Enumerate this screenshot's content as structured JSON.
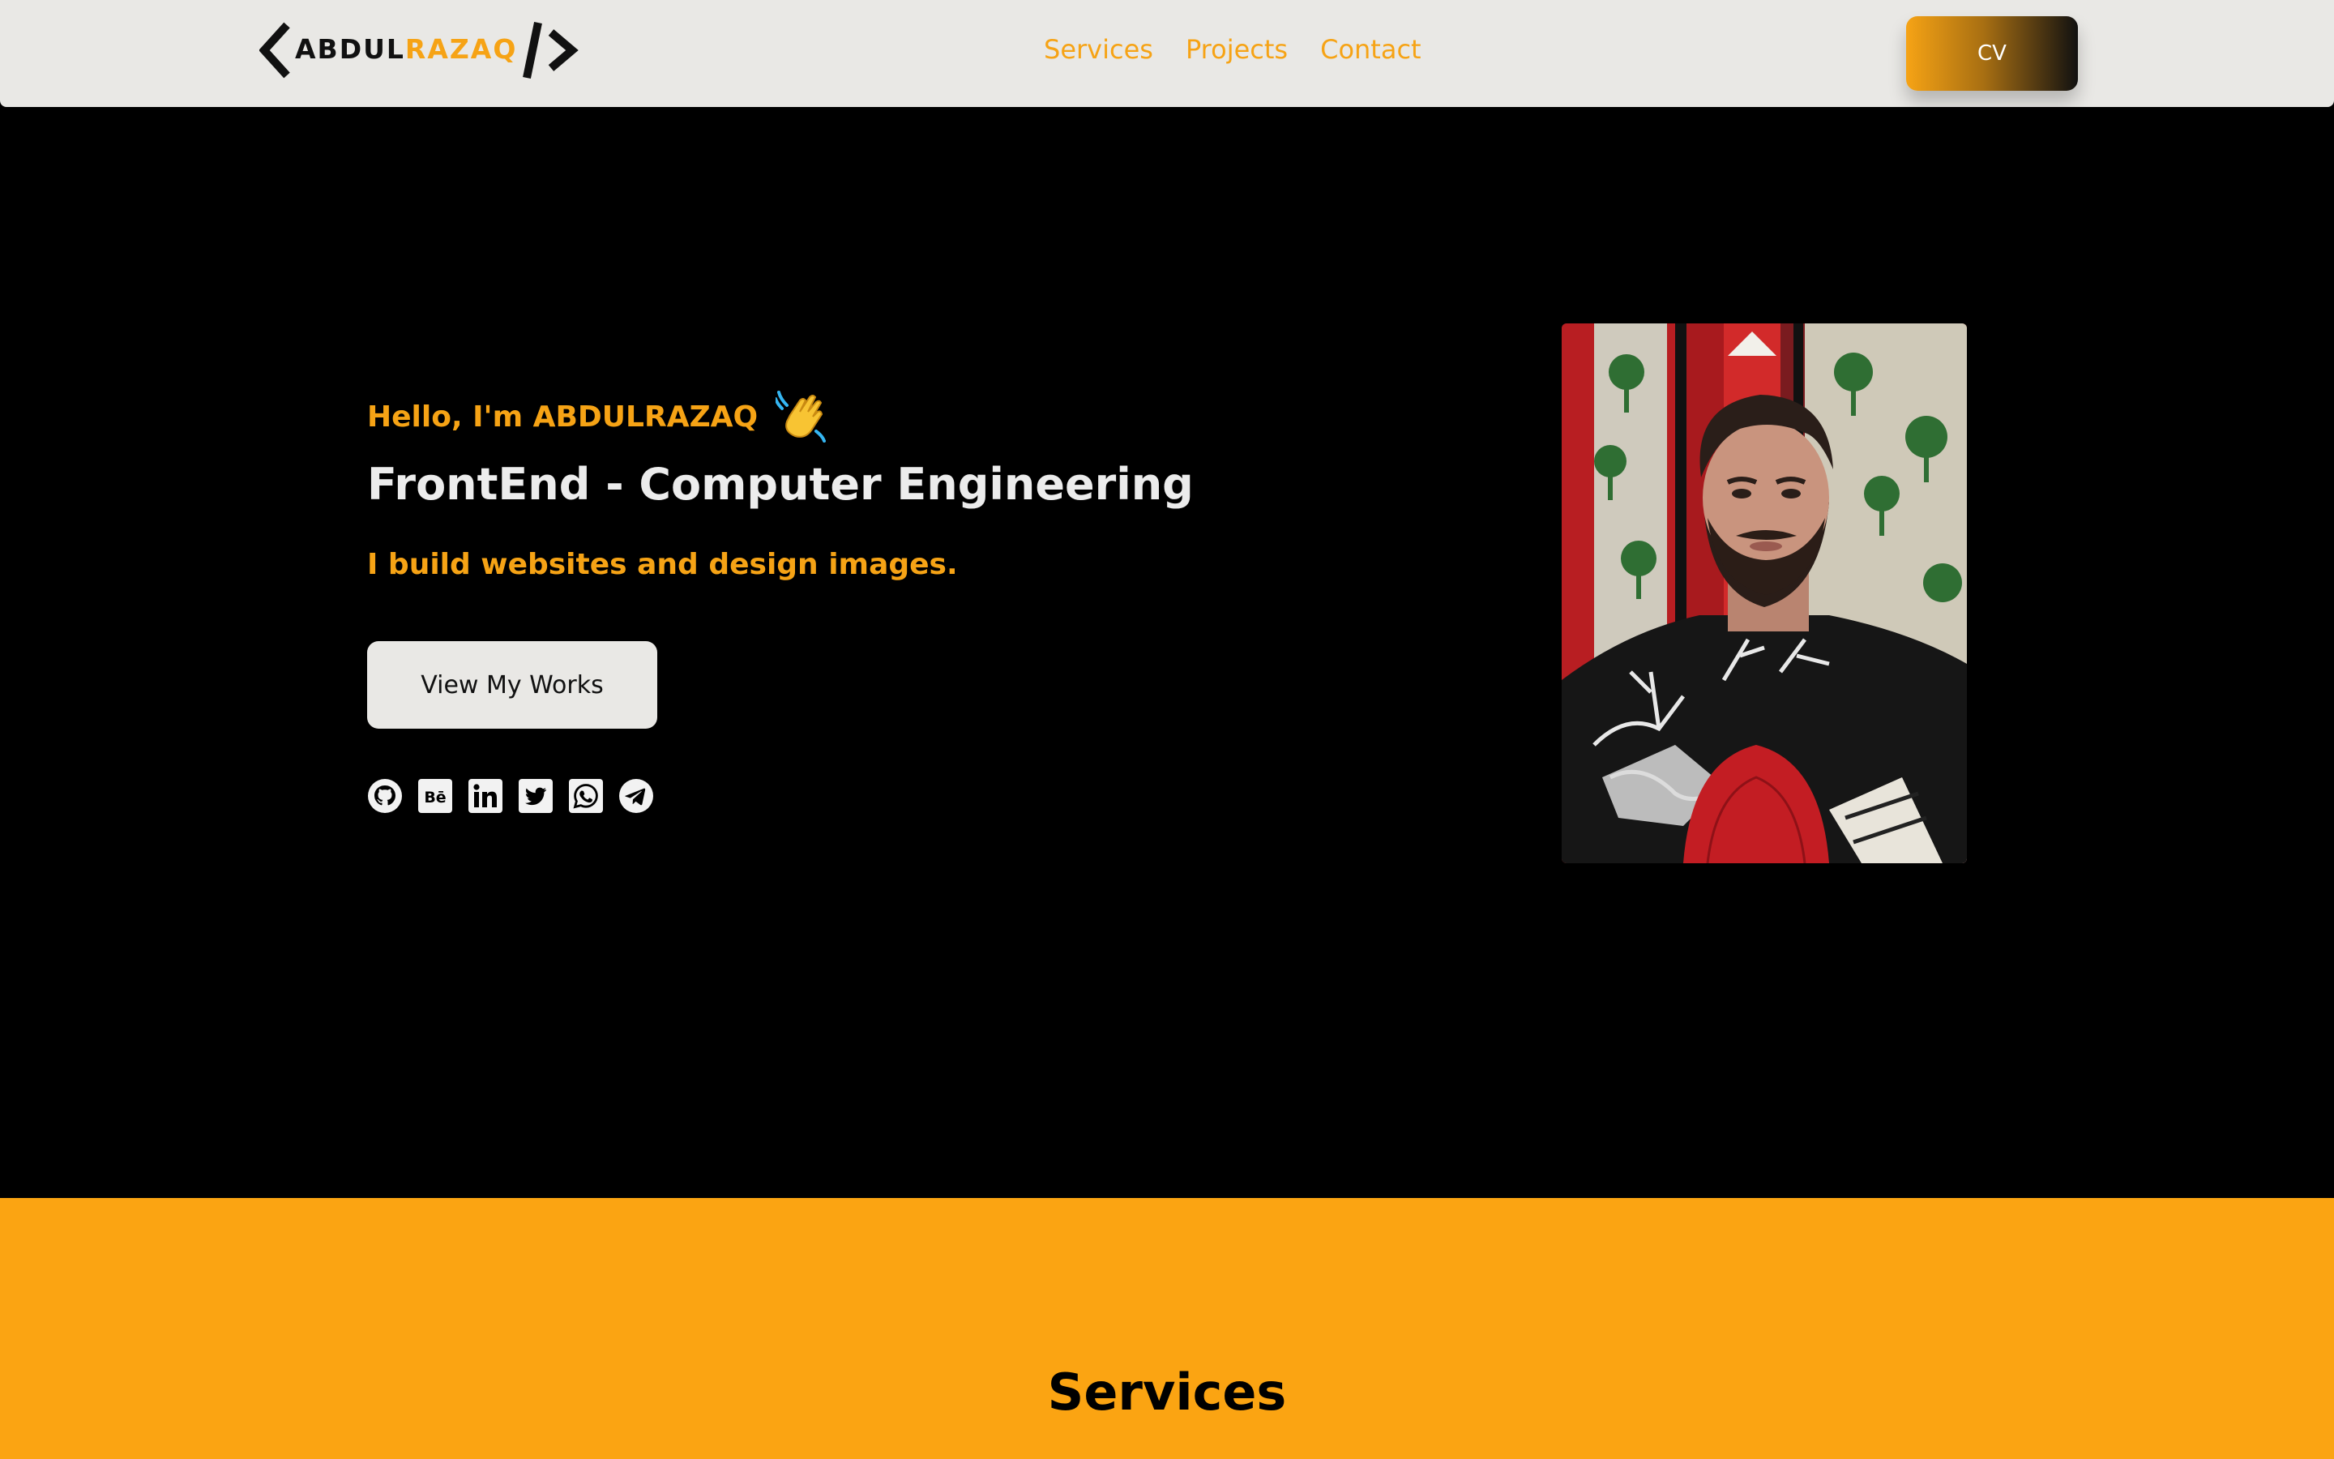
{
  "navbar": {
    "logo": {
      "part_a": "ABDUL",
      "part_b": "RAZAQ"
    },
    "links": [
      {
        "label": "Services"
      },
      {
        "label": "Projects"
      },
      {
        "label": "Contact"
      }
    ],
    "cv_label": "CV"
  },
  "hero": {
    "greeting": "Hello, I'm ABDULRAZAQ",
    "headline": "FrontEnd - Computer Engineering",
    "tagline": "I build websites and design images.",
    "cta_label": "View My Works",
    "socials": [
      {
        "icon": "github-icon"
      },
      {
        "icon": "behance-icon"
      },
      {
        "icon": "linkedin-icon"
      },
      {
        "icon": "twitter-icon"
      },
      {
        "icon": "whatsapp-icon"
      },
      {
        "icon": "telegram-icon"
      }
    ]
  },
  "services": {
    "title": "Services"
  },
  "colors": {
    "accent": "#f6a315",
    "navbar_bg": "#e9e8e5",
    "hero_bg": "#000000",
    "services_bg": "#fba412"
  }
}
